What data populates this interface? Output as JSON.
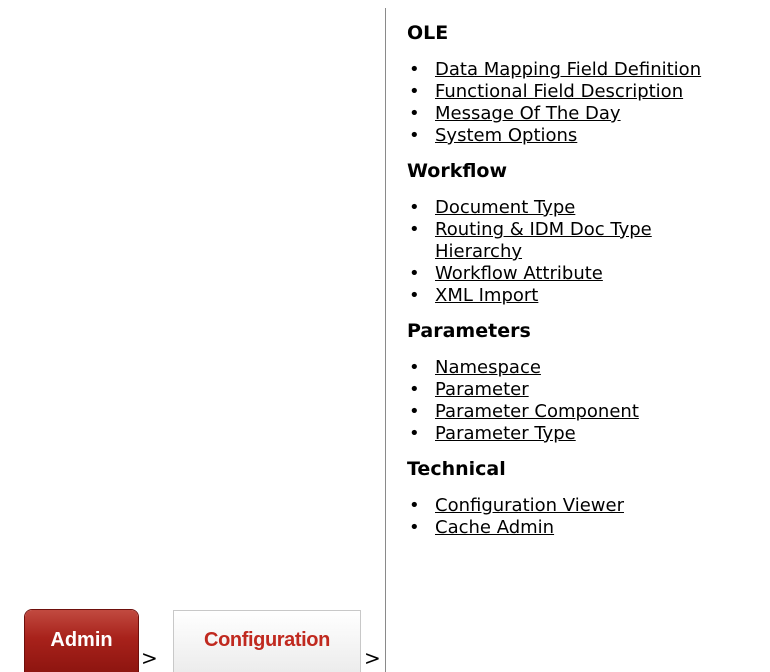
{
  "sections": [
    {
      "title": "OLE",
      "links": [
        "Data Mapping Field Definition",
        "Functional Field Description",
        "Message Of The Day",
        "System Options"
      ]
    },
    {
      "title": "Workflow",
      "links": [
        "Document Type",
        "Routing & IDM Doc Type Hierarchy",
        "Workflow Attribute",
        "XML Import"
      ]
    },
    {
      "title": "Parameters",
      "links": [
        "Namespace",
        "Parameter",
        "Parameter Component",
        "Parameter Type"
      ]
    },
    {
      "title": "Technical",
      "links": [
        "Configuration Viewer",
        "Cache Admin"
      ]
    }
  ],
  "breadcrumbs": {
    "tabs": [
      "Admin",
      "Configuration"
    ],
    "separator": ">"
  },
  "bullet": "•",
  "colors": {
    "admin_tab": "#a8221b",
    "config_text": "#c0291f",
    "link": "#000000"
  }
}
